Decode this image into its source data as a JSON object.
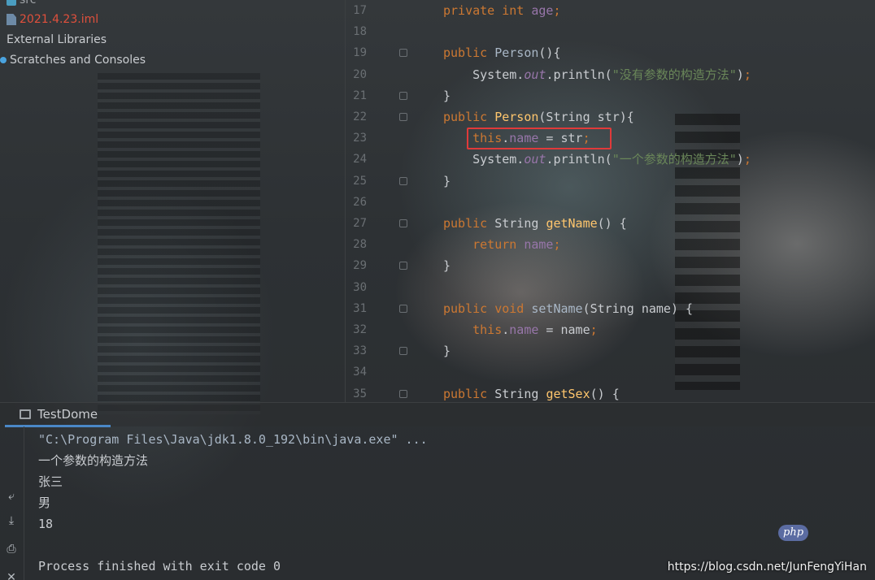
{
  "project_tree": {
    "items": [
      {
        "label": "src",
        "color": "#a0a4a8"
      },
      {
        "label": "2021.4.23.iml",
        "color": "#e0503c"
      },
      {
        "label": "External Libraries",
        "color": "#c9ccd0"
      },
      {
        "label": "Scratches and Consoles",
        "color": "#c9ccd0"
      }
    ]
  },
  "editor": {
    "lines": [
      {
        "num": "17",
        "tokens": [
          [
            "kw",
            "private int "
          ],
          [
            "fld",
            "age"
          ],
          [
            "kw",
            ";"
          ]
        ]
      },
      {
        "num": "18",
        "tokens": []
      },
      {
        "num": "19",
        "tokens": [
          [
            "kw",
            "public "
          ],
          [
            "cls",
            "Person"
          ],
          [
            "code",
            "(){"
          ]
        ]
      },
      {
        "num": "20",
        "tokens": [
          [
            "code",
            "    System."
          ],
          [
            "sta",
            "out"
          ],
          [
            "code",
            ".println("
          ],
          [
            "str",
            "\"没有参数的构造方法\""
          ],
          [
            "code",
            ")"
          ],
          [
            "kw",
            ";"
          ]
        ]
      },
      {
        "num": "21",
        "tokens": [
          [
            "code",
            "}"
          ]
        ]
      },
      {
        "num": "22",
        "tokens": [
          [
            "kw",
            "public "
          ],
          [
            "fn",
            "Person"
          ],
          [
            "code",
            "(String str){"
          ]
        ]
      },
      {
        "num": "23",
        "tokens": [
          [
            "code",
            "    "
          ],
          [
            "kw",
            "this"
          ],
          [
            "code",
            "."
          ],
          [
            "fld",
            "name"
          ],
          [
            "code",
            " = str"
          ],
          [
            "kw",
            ";"
          ]
        ]
      },
      {
        "num": "24",
        "tokens": [
          [
            "code",
            "    System."
          ],
          [
            "sta",
            "out"
          ],
          [
            "code",
            ".println("
          ],
          [
            "str",
            "\"一个参数的构造方法\""
          ],
          [
            "code",
            ")"
          ],
          [
            "kw",
            ";"
          ]
        ]
      },
      {
        "num": "25",
        "tokens": [
          [
            "code",
            "}"
          ]
        ]
      },
      {
        "num": "26",
        "tokens": []
      },
      {
        "num": "27",
        "tokens": [
          [
            "kw",
            "public "
          ],
          [
            "code",
            "String "
          ],
          [
            "fn",
            "getName"
          ],
          [
            "code",
            "() {"
          ]
        ]
      },
      {
        "num": "28",
        "tokens": [
          [
            "code",
            "    "
          ],
          [
            "kw",
            "return "
          ],
          [
            "fld",
            "name"
          ],
          [
            "kw",
            ";"
          ]
        ]
      },
      {
        "num": "29",
        "tokens": [
          [
            "code",
            "}"
          ]
        ]
      },
      {
        "num": "30",
        "tokens": []
      },
      {
        "num": "31",
        "tokens": [
          [
            "kw",
            "public void "
          ],
          [
            "cls",
            "setName"
          ],
          [
            "code",
            "(String name) {"
          ]
        ]
      },
      {
        "num": "32",
        "tokens": [
          [
            "code",
            "    "
          ],
          [
            "kw",
            "this"
          ],
          [
            "code",
            "."
          ],
          [
            "fld",
            "name"
          ],
          [
            "code",
            " = name"
          ],
          [
            "kw",
            ";"
          ]
        ]
      },
      {
        "num": "33",
        "tokens": [
          [
            "code",
            "}"
          ]
        ]
      },
      {
        "num": "34",
        "tokens": []
      },
      {
        "num": "35",
        "tokens": [
          [
            "kw",
            "public "
          ],
          [
            "code",
            "String "
          ],
          [
            "fn",
            "getSex"
          ],
          [
            "code",
            "() {"
          ]
        ]
      }
    ]
  },
  "run_panel": {
    "tab_label": "TestDome",
    "console_lines": [
      "\"C:\\Program Files\\Java\\jdk1.8.0_192\\bin\\java.exe\" ...",
      "一个参数的构造方法",
      "张三",
      "男",
      "18",
      "",
      "Process finished with exit code 0"
    ]
  },
  "watermark": {
    "url": "https://blog.csdn.net/JunFengYiHan",
    "badge": "php"
  }
}
